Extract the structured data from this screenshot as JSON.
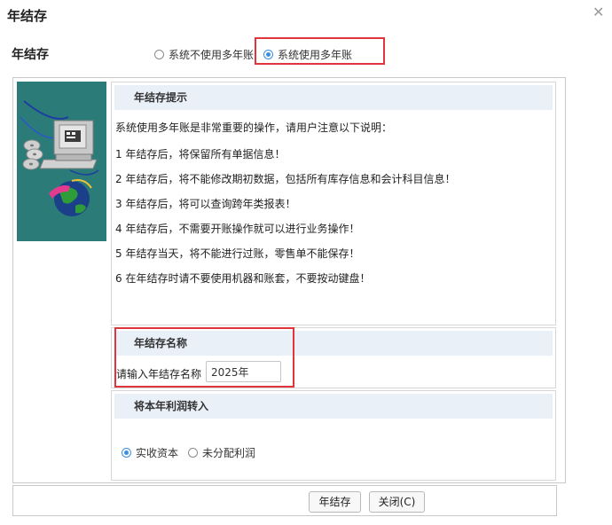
{
  "dialog": {
    "title": "年结存",
    "close_icon": "close-icon"
  },
  "mode": {
    "label": "年结存",
    "options": [
      {
        "label": "系统不使用多年账",
        "selected": false
      },
      {
        "label": "系统使用多年账",
        "selected": true
      }
    ]
  },
  "tips": {
    "header": "年结存提示",
    "intro": "系统使用多年账是非常重要的操作，请用户注意以下说明：",
    "lines": [
      "1 年结存后，将保留所有单据信息！",
      "2 年结存后，将不能修改期初数据，包括所有库存信息和会计科目信息！",
      "3 年结存后，将可以查询跨年类报表！",
      "4 年结存后，不需要开账操作就可以进行业务操作！",
      "5 年结存当天，将不能进行过账，零售单不能保存！",
      "6 在年结存时请不要使用机器和账套，不要按动键盘！"
    ]
  },
  "name_section": {
    "header": "年结存名称",
    "label": "请输入年结存名称",
    "value": "2025年"
  },
  "profit_section": {
    "header": "将本年利润转入",
    "options": [
      {
        "label": "实收资本",
        "selected": true
      },
      {
        "label": "未分配利润",
        "selected": false
      }
    ]
  },
  "buttons": {
    "confirm": "年结存",
    "close": "关闭(C)"
  },
  "colors": {
    "accent": "#3b8fe0",
    "highlight_border": "#e0353d",
    "section_header_bg": "#eaf0f8",
    "image_bg": "#2b7c79"
  }
}
